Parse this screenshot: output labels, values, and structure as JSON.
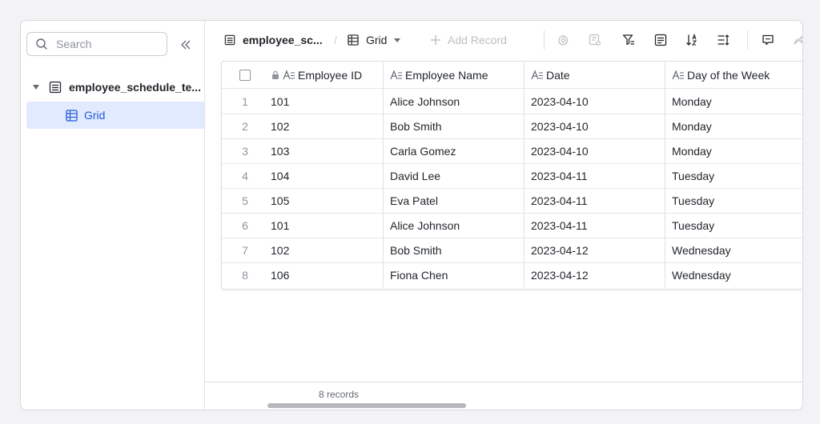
{
  "sidebar": {
    "search_placeholder": "Search",
    "table_name": "employee_schedule_te...",
    "view_name": "Grid"
  },
  "toolbar": {
    "table_name": "employee_sc...",
    "view_name": "Grid",
    "add_record": "Add Record"
  },
  "grid": {
    "columns": [
      "Employee ID",
      "Employee Name",
      "Date",
      "Day of the Week"
    ],
    "rows": [
      {
        "idx": "1",
        "id": "101",
        "name": "Alice Johnson",
        "date": "2023-04-10",
        "day": "Monday"
      },
      {
        "idx": "2",
        "id": "102",
        "name": "Bob Smith",
        "date": "2023-04-10",
        "day": "Monday"
      },
      {
        "idx": "3",
        "id": "103",
        "name": "Carla Gomez",
        "date": "2023-04-10",
        "day": "Monday"
      },
      {
        "idx": "4",
        "id": "104",
        "name": "David Lee",
        "date": "2023-04-11",
        "day": "Tuesday"
      },
      {
        "idx": "5",
        "id": "105",
        "name": "Eva Patel",
        "date": "2023-04-11",
        "day": "Tuesday"
      },
      {
        "idx": "6",
        "id": "101",
        "name": "Alice Johnson",
        "date": "2023-04-11",
        "day": "Tuesday"
      },
      {
        "idx": "7",
        "id": "102",
        "name": "Bob Smith",
        "date": "2023-04-12",
        "day": "Wednesday"
      },
      {
        "idx": "8",
        "id": "106",
        "name": "Fiona Chen",
        "date": "2023-04-12",
        "day": "Wednesday"
      }
    ]
  },
  "footer": {
    "records": "8 records"
  },
  "colors": {
    "accent": "#245bdb",
    "selected_bg": "#e1eaff"
  }
}
